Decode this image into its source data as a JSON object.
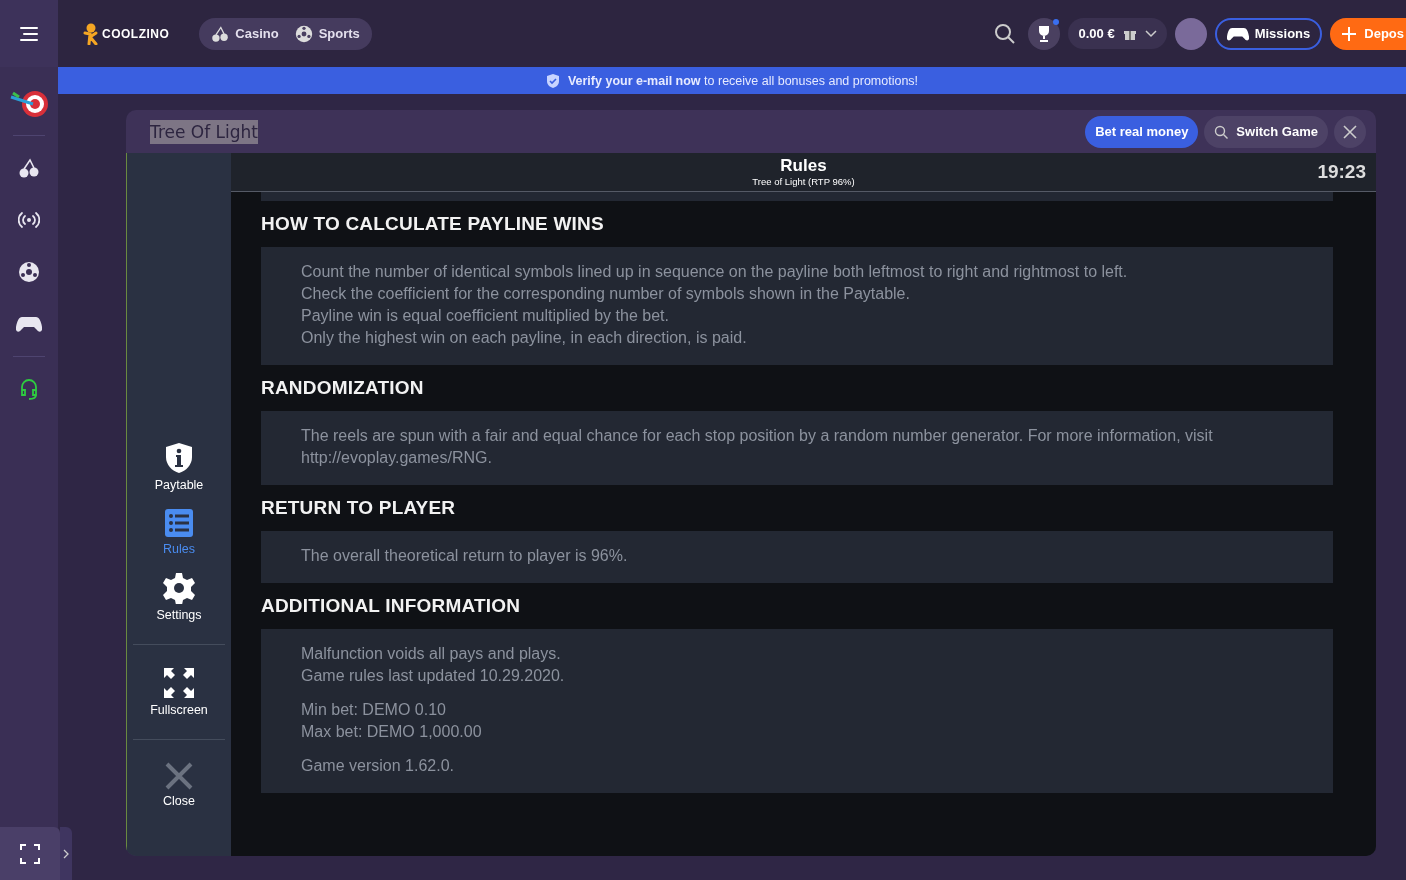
{
  "brand": {
    "name": "COOLZINO"
  },
  "nav_pills": [
    {
      "label": "Casino"
    },
    {
      "label": "Sports"
    }
  ],
  "header": {
    "balance": "0.00 €",
    "missions": "Missions",
    "deposit": "Depos"
  },
  "banner": {
    "text": "**Verify your e-mail now** to receive all bonuses and promotions!"
  },
  "rail": [
    {
      "active": false
    },
    {
      "active": false
    },
    {
      "active": false
    },
    {
      "active": false
    },
    {
      "active": true
    }
  ],
  "game": {
    "title": "Tree Of Light",
    "bet_real": "Bet real money",
    "switch_game": "Switch Game"
  },
  "game_menu": [
    {
      "label": "Paytable",
      "selected": false
    },
    {
      "label": "Rules",
      "selected": true
    },
    {
      "label": "Settings",
      "selected": false
    },
    {
      "label": "Fullscreen",
      "selected": false
    },
    {
      "label": "Close",
      "selected": false
    }
  ],
  "rules": {
    "title": "Rules",
    "subtitle": "Tree of Light (RTP 96%)",
    "time": "19:23",
    "sections": [
      {
        "heading": "HOW TO CALCULATE PAYLINE WINS",
        "blocks": [
          [
            "Count the number of identical symbols lined up in sequence on the payline both leftmost to right and rightmost to left.",
            "Check the coefficient for the corresponding number of symbols shown in the Paytable.",
            "Payline win is equal coefficient multiplied by the bet.",
            "Only the highest win on each payline, in each direction, is paid."
          ]
        ]
      },
      {
        "heading": "RANDOMIZATION",
        "blocks": [
          [
            "The reels are spun with a fair and equal chance for each stop position by a random number generator. For more information, visit http://evoplay.games/RNG."
          ]
        ]
      },
      {
        "heading": "RETURN TO PLAYER",
        "blocks": [
          [
            "The overall theoretical return to player is 96%."
          ]
        ]
      },
      {
        "heading": "ADDITIONAL INFORMATION",
        "blocks": [
          [
            "Malfunction voids all pays and plays.",
            "Game rules last updated 10.29.2020."
          ],
          [
            "Min bet: DEMO 0.10",
            "Max bet: DEMO 1,000.00"
          ],
          [
            "Game version 1.62.0."
          ]
        ]
      }
    ]
  }
}
